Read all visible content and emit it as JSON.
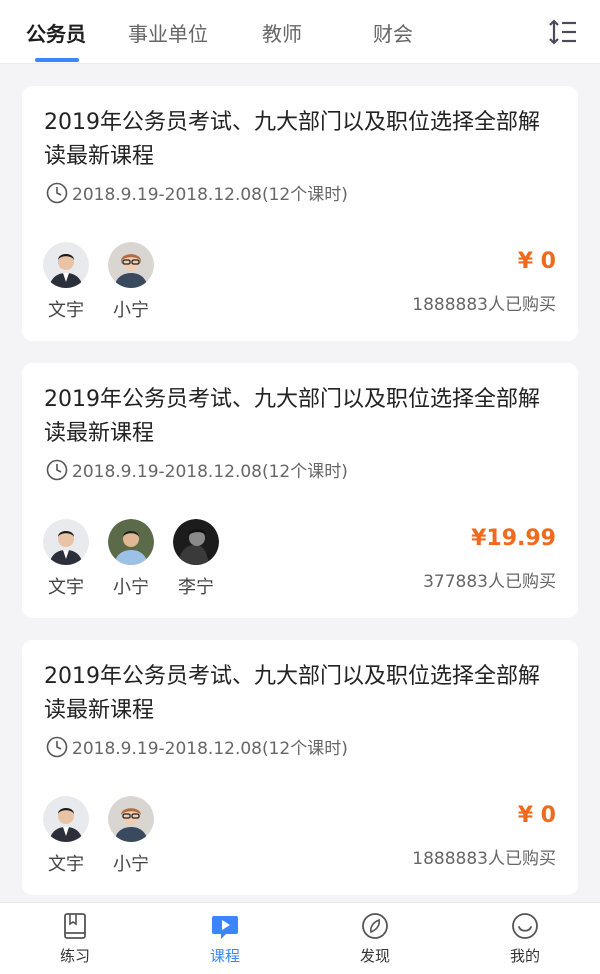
{
  "tabs": [
    {
      "label": "公务员"
    },
    {
      "label": "事业单位"
    },
    {
      "label": "教师"
    },
    {
      "label": "财会"
    }
  ],
  "courses": [
    {
      "title": "2019年公务员考试、九大部门以及职位选择全部解读最新课程",
      "time": "2018.9.19-2018.12.08(12个课时)",
      "teachers": [
        {
          "name": "文宇"
        },
        {
          "name": "小宁"
        }
      ],
      "price": "¥ 0",
      "buyers": "1888883人已购买"
    },
    {
      "title": "2019年公务员考试、九大部门以及职位选择全部解读最新课程",
      "time": "2018.9.19-2018.12.08(12个课时)",
      "teachers": [
        {
          "name": "文宇"
        },
        {
          "name": "小宁"
        },
        {
          "name": "李宁"
        }
      ],
      "price": "¥19.99",
      "buyers": "377883人已购买"
    },
    {
      "title": "2019年公务员考试、九大部门以及职位选择全部解读最新课程",
      "time": "2018.9.19-2018.12.08(12个课时)",
      "teachers": [
        {
          "name": "文宇"
        },
        {
          "name": "小宁"
        }
      ],
      "price": "¥ 0",
      "buyers": "1888883人已购买"
    }
  ],
  "bottom_nav": [
    {
      "label": "练习",
      "icon": "book-icon"
    },
    {
      "label": "课程",
      "icon": "video-icon"
    },
    {
      "label": "发现",
      "icon": "compass-icon"
    },
    {
      "label": "我的",
      "icon": "smile-icon"
    }
  ],
  "colors": {
    "accent": "#3b86ff",
    "price": "#f06a1d",
    "background": "#f4f4f6"
  }
}
